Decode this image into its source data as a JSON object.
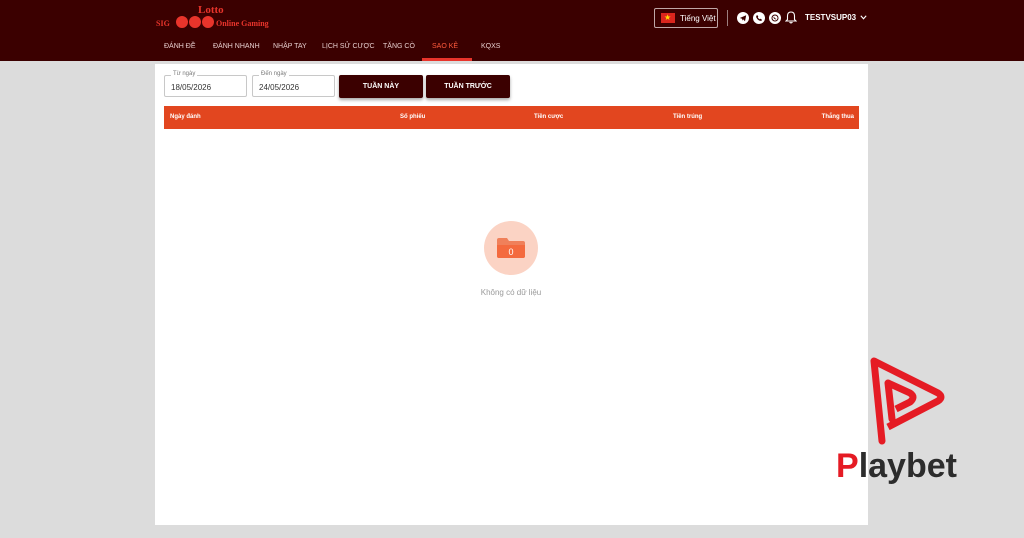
{
  "header": {
    "logo": {
      "top": "Lotto",
      "left": "SIG",
      "right": "Online Gaming"
    },
    "language_label": "Tiếng Việt",
    "username": "TESTVSUP03",
    "social_icons": [
      "telegram-icon",
      "viber-icon",
      "whatsapp-icon"
    ],
    "bell_icon": "bell-icon"
  },
  "nav": {
    "items": [
      {
        "label": "ĐÁNH ĐỀ"
      },
      {
        "label": "ĐÁNH NHANH"
      },
      {
        "label": "NHẬP TAY"
      },
      {
        "label": "LỊCH SỬ CƯỢC"
      },
      {
        "label": "TẶNG CÒ"
      },
      {
        "label": "SAO KÊ"
      },
      {
        "label": "KQXS"
      }
    ],
    "active_index": 5
  },
  "filters": {
    "from": {
      "label": "Từ ngày",
      "value": "18/05/2026"
    },
    "to": {
      "label": "Đến ngày",
      "value": "24/05/2026"
    },
    "this_week_label": "TUẦN NÀY",
    "last_week_label": "TUẦN TRƯỚC"
  },
  "table": {
    "headers": [
      "Ngày đánh",
      "Số phiếu",
      "Tiền cược",
      "Tiền trúng",
      "Thắng thua"
    ],
    "empty_badge": "0",
    "empty_text": "Không có dữ liệu"
  },
  "watermark": {
    "brand_initial": "P",
    "brand_rest": "laybet"
  },
  "colors": {
    "header_bg": "#3b0000",
    "accent": "#e2461f",
    "active_nav": "#ff5a3c",
    "page_bg": "#dcdcdc",
    "empty_circle": "#fbd3c4",
    "brand_red": "#e51b24"
  }
}
